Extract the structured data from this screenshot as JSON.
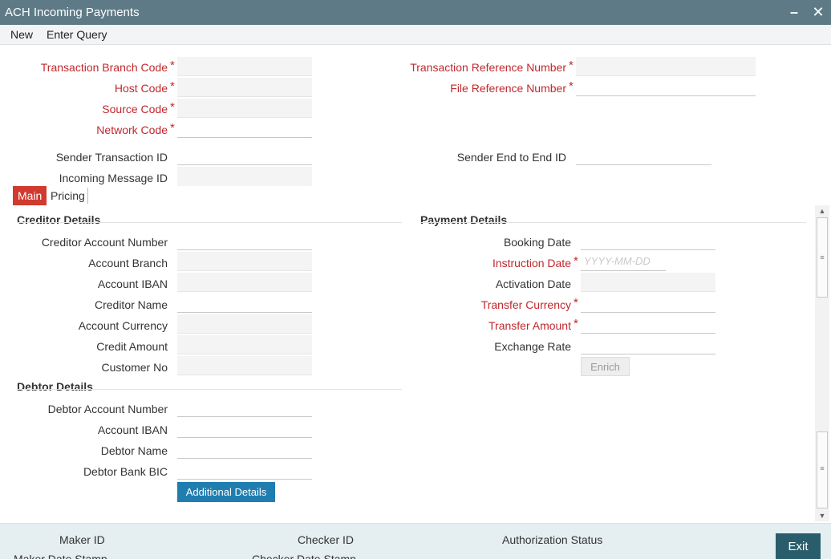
{
  "window": {
    "title": "ACH Incoming Payments"
  },
  "menu": {
    "new": "New",
    "enter_query": "Enter Query"
  },
  "header": {
    "transaction_branch_code": {
      "label": "Transaction Branch Code",
      "value": ""
    },
    "host_code": {
      "label": "Host Code",
      "value": ""
    },
    "source_code": {
      "label": "Source Code",
      "value": ""
    },
    "network_code": {
      "label": "Network Code",
      "value": ""
    },
    "sender_transaction_id": {
      "label": "Sender Transaction ID",
      "value": ""
    },
    "incoming_message_id": {
      "label": "Incoming Message ID",
      "value": ""
    },
    "transaction_reference_number": {
      "label": "Transaction Reference Number",
      "value": ""
    },
    "file_reference_number": {
      "label": "File Reference Number",
      "value": ""
    },
    "sender_end_to_end_id": {
      "label": "Sender End to End ID",
      "value": ""
    }
  },
  "tabs": {
    "main": "Main",
    "pricing": "Pricing"
  },
  "creditor": {
    "title": "Creditor Details",
    "creditor_account_number": "Creditor Account Number",
    "account_branch": "Account Branch",
    "account_iban": "Account IBAN",
    "creditor_name": "Creditor Name",
    "account_currency": "Account Currency",
    "credit_amount": "Credit Amount",
    "customer_no": "Customer No"
  },
  "debtor": {
    "title": "Debtor Details",
    "debtor_account_number": "Debtor Account Number",
    "account_iban": "Account IBAN",
    "debtor_name": "Debtor Name",
    "debtor_bank_bic": "Debtor Bank BIC",
    "additional_details": "Additional Details"
  },
  "payment": {
    "title": "Payment Details",
    "booking_date": "Booking Date",
    "instruction_date": "Instruction Date",
    "instruction_date_placeholder": "YYYY-MM-DD",
    "activation_date": "Activation Date",
    "transfer_currency": "Transfer Currency",
    "transfer_amount": "Transfer Amount",
    "exchange_rate": "Exchange Rate",
    "enrich": "Enrich"
  },
  "footer": {
    "maker_id": "Maker ID",
    "checker_id": "Checker ID",
    "authorization_status": "Authorization Status",
    "maker_date_stamp": "Maker Date Stamp",
    "checker_date_stamp": "Checker Date Stamp",
    "exit": "Exit"
  },
  "required_mark": "*",
  "icons": {
    "minimize": "minimize-icon",
    "close": "close-icon"
  },
  "colors": {
    "titlebar": "#5e7a87",
    "required": "#c0282e",
    "active_tab": "#d13a2e",
    "button": "#1f7eaf",
    "exit": "#2a5d6b"
  }
}
